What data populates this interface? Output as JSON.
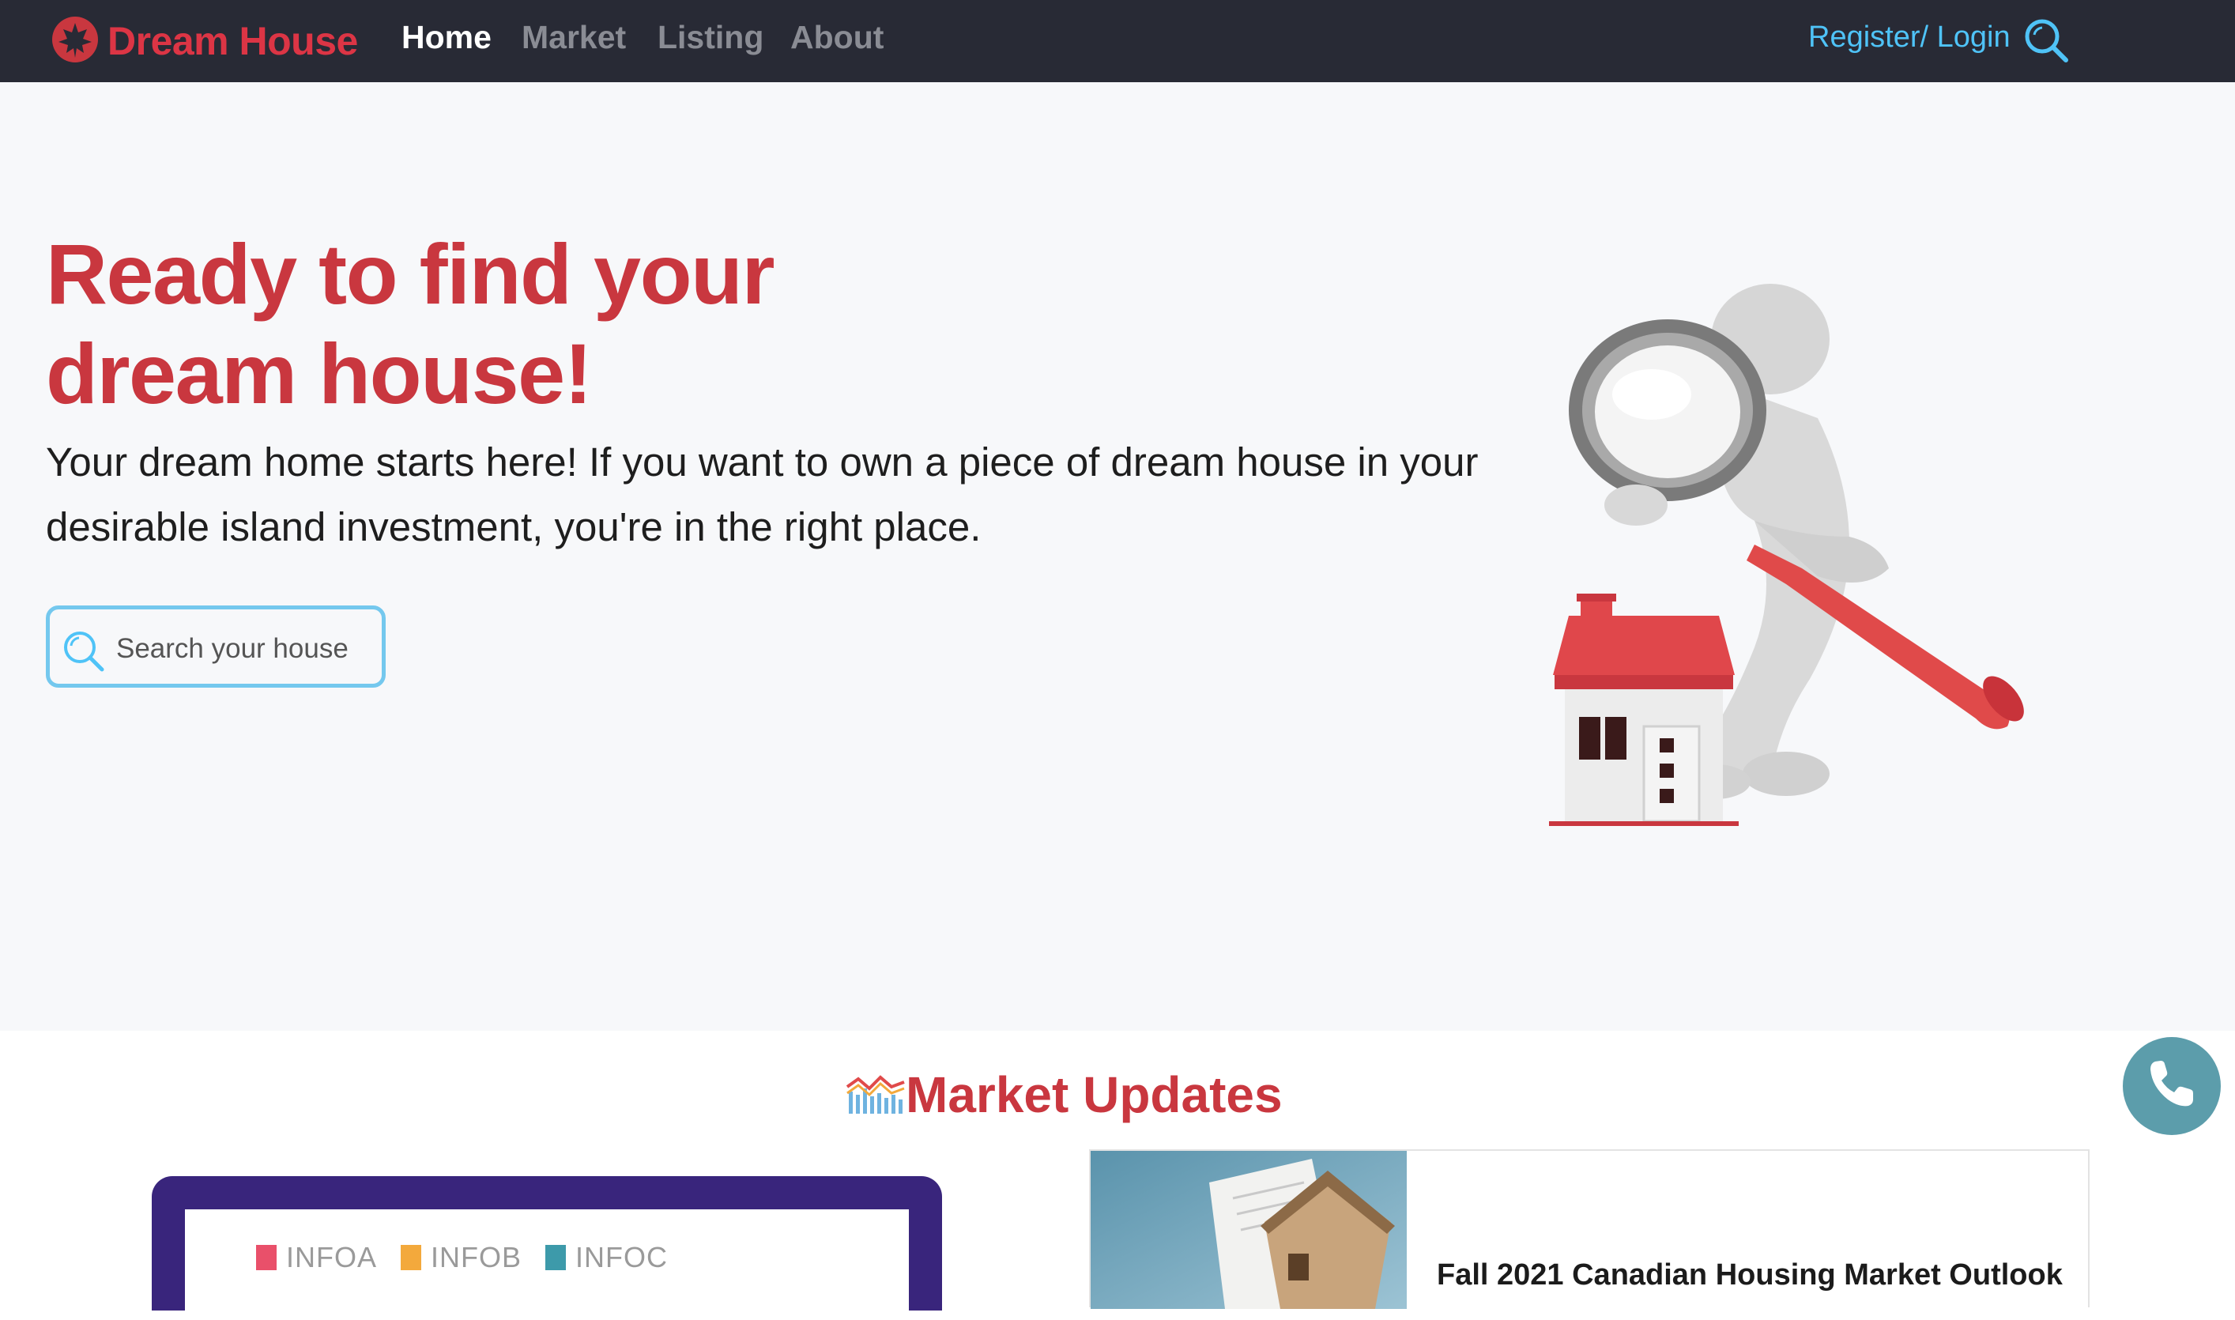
{
  "nav": {
    "brand": "Dream House",
    "links": [
      "Home",
      "Market",
      "Listing",
      "About"
    ],
    "active": "Home",
    "register_login": "Register/ Login"
  },
  "hero": {
    "title_line1": "Ready to find your",
    "title_line2": "dream house!",
    "description": "Your dream home starts here! If you want to own a piece of dream house in your desirable island investment, you're in the right place.",
    "search_placeholder": "Search your house"
  },
  "market": {
    "section_title": "Market Updates",
    "chart_legend": [
      "INFOA",
      "INFOB",
      "INFOC"
    ],
    "news_title": "Fall 2021 Canadian Housing Market Outlook"
  },
  "colors": {
    "brand_red": "#c9373f",
    "nav_bg": "#282a35",
    "accent_blue": "#4fc3f7",
    "phone_btn": "#5c9dab",
    "chart_frame": "#39257c",
    "legend_a": "#e9506a",
    "legend_b": "#f3a93c",
    "legend_c": "#3d9aaa"
  },
  "icons": {
    "brand": "maple-leaf-icon",
    "search": "search-icon",
    "market": "chart-trend-icon",
    "phone": "phone-icon"
  }
}
